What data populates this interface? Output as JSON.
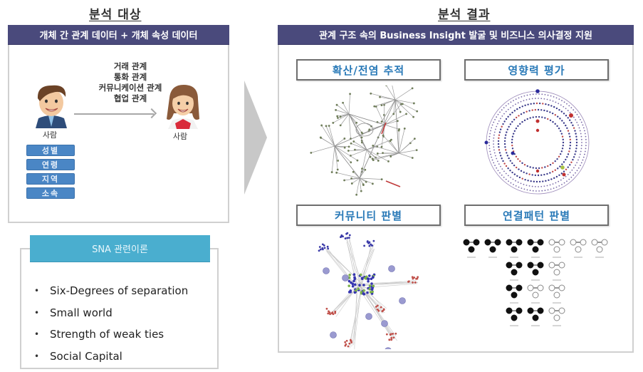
{
  "left": {
    "title": "분석 대상",
    "band": "개체 간 관계 데이터 + 개체 속성 데이터",
    "relations": [
      "거래 관계",
      "통화 관계",
      "커뮤니케이션 관계",
      "협업 관계"
    ],
    "person_left_label": "사람",
    "person_right_label": "사람",
    "person_left_icon": "man-avatar-icon",
    "person_right_icon": "woman-avatar-icon",
    "attributes": [
      "성별",
      "연령",
      "지역",
      "소속"
    ],
    "sna": {
      "header": "SNA 관련이론",
      "items": [
        "Six-Degrees of separation",
        "Small world",
        "Strength of weak ties",
        "Social Capital"
      ]
    }
  },
  "right": {
    "title": "분석 결과",
    "band": "관계 구조 속의 Business Insight 발굴 및 비즈니스 의사결정 지원",
    "panels": [
      {
        "title": "확산/전염 추적",
        "visual": "diffusion-network-graph"
      },
      {
        "title": "영향력 평가",
        "visual": "circular-influence-graph"
      },
      {
        "title": "커뮤니티 판별",
        "visual": "community-cluster-graph"
      },
      {
        "title": "연결패턴 판별",
        "visual": "triad-motif-grid"
      }
    ]
  },
  "colors": {
    "band": "#4a4a7c",
    "sna_header": "#4aaecf",
    "attribute_pill": "#4a86c5",
    "panel_title_text": "#2a7ab8",
    "chevron": "#c8c8c8"
  }
}
